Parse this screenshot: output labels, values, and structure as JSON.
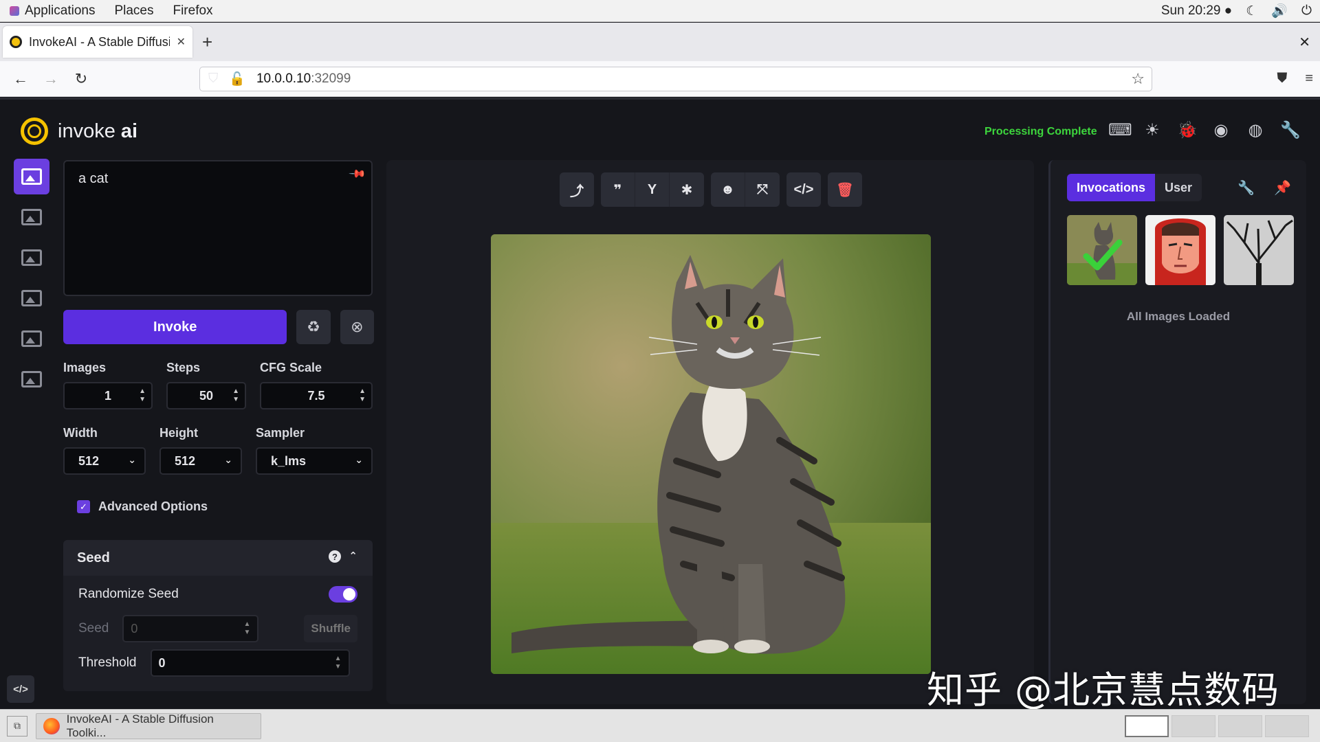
{
  "system_bar": {
    "applications": "Applications",
    "places": "Places",
    "firefox": "Firefox",
    "clock": "Sun 20:29 ●"
  },
  "browser": {
    "tab_title": "InvokeAI - A Stable Diffusi",
    "url_host": "10.0.0.10",
    "url_port": ":32099"
  },
  "app": {
    "logo_text": "invoke",
    "logo_bold": "ai",
    "status": "Processing Complete",
    "accent": "#5b2ee0",
    "status_color": "#3dd63d"
  },
  "left_panel": {
    "prompt": "a cat",
    "invoke_label": "Invoke",
    "images_label": "Images",
    "images_value": "1",
    "steps_label": "Steps",
    "steps_value": "50",
    "cfg_label": "CFG Scale",
    "cfg_value": "7.5",
    "width_label": "Width",
    "width_value": "512",
    "height_label": "Height",
    "height_value": "512",
    "sampler_label": "Sampler",
    "sampler_value": "k_lms",
    "advanced_label": "Advanced Options",
    "advanced_checked": true,
    "seed_section": "Seed",
    "randomize_label": "Randomize Seed",
    "randomize_on": true,
    "seed_label": "Seed",
    "seed_value": "0",
    "shuffle_label": "Shuffle",
    "threshold_label": "Threshold",
    "threshold_value": "0"
  },
  "gallery": {
    "tab_invocations": "Invocations",
    "tab_user": "User",
    "all_loaded": "All Images Loaded"
  },
  "taskbar": {
    "task_title": "InvokeAI - A Stable Diffusion Toolki..."
  },
  "watermark": "知乎 @北京慧点数码"
}
